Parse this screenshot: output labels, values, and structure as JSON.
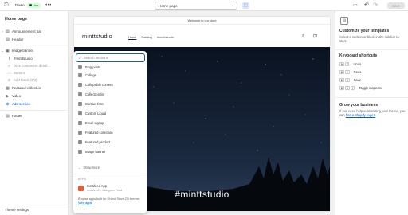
{
  "topbar": {
    "theme_name": "Dawn",
    "live_badge": "Live",
    "more": "•••",
    "page_selector": "Home page",
    "save_label": "Save"
  },
  "left_panel": {
    "title": "Home page",
    "items": [
      {
        "label": "Announcement bar"
      },
      {
        "label": "Header"
      },
      {
        "label": "Image banner"
      },
      {
        "label": "#minttstudio"
      },
      {
        "label": "Give customers detail..."
      },
      {
        "label": "Buttons"
      },
      {
        "label": "Add block (3/3)"
      },
      {
        "label": "Featured collection"
      },
      {
        "label": "Video"
      },
      {
        "label": "Add section"
      },
      {
        "label": "Footer"
      }
    ],
    "theme_settings": "Theme settings"
  },
  "picker": {
    "search_placeholder": "Search sections",
    "items": [
      "Blog posts",
      "Collage",
      "Collapsible content",
      "Collection list",
      "Contact form",
      "Custom Liquid",
      "Email signup",
      "Featured collection",
      "Featured product",
      "Image banner"
    ],
    "show_more": "Show more",
    "apps_heading": "APPS",
    "app_name": "Instafeed App",
    "app_sub": "Instafeed – Instagram Feed",
    "footer_text": "Browse apps built for Online Store 2.0 themes.",
    "footer_link": "View apps"
  },
  "preview": {
    "announcement": "Welcome to our store",
    "brand": "minttstudio",
    "nav": [
      "Home",
      "Catalog",
      "#minttstudio"
    ],
    "banner_heading": "#minttstudio"
  },
  "right_panel": {
    "customize_title": "Customize your templates",
    "customize_text": "Select a section or block in the sidebar to start.",
    "shortcuts_title": "Keyboard shortcuts",
    "shortcuts": [
      {
        "keys": [
          "⌘",
          "Z"
        ],
        "label": "Undo"
      },
      {
        "keys": [
          "⌘",
          "Y"
        ],
        "label": "Redo"
      },
      {
        "keys": [
          "⌘",
          "S"
        ],
        "label": "Save"
      },
      {
        "keys": [
          "⌘",
          "⇧",
          "I"
        ],
        "label": "Toggle inspector"
      }
    ],
    "grow_title": "Grow your business",
    "grow_text": "If you need help customizing your theme, you can",
    "grow_link": "hire a Shopify expert"
  },
  "colors": {
    "accent": "#005bd3",
    "live_bg": "#cdfed4",
    "banner_bg": "#0d1522",
    "app_logo": "#ee5a36"
  }
}
